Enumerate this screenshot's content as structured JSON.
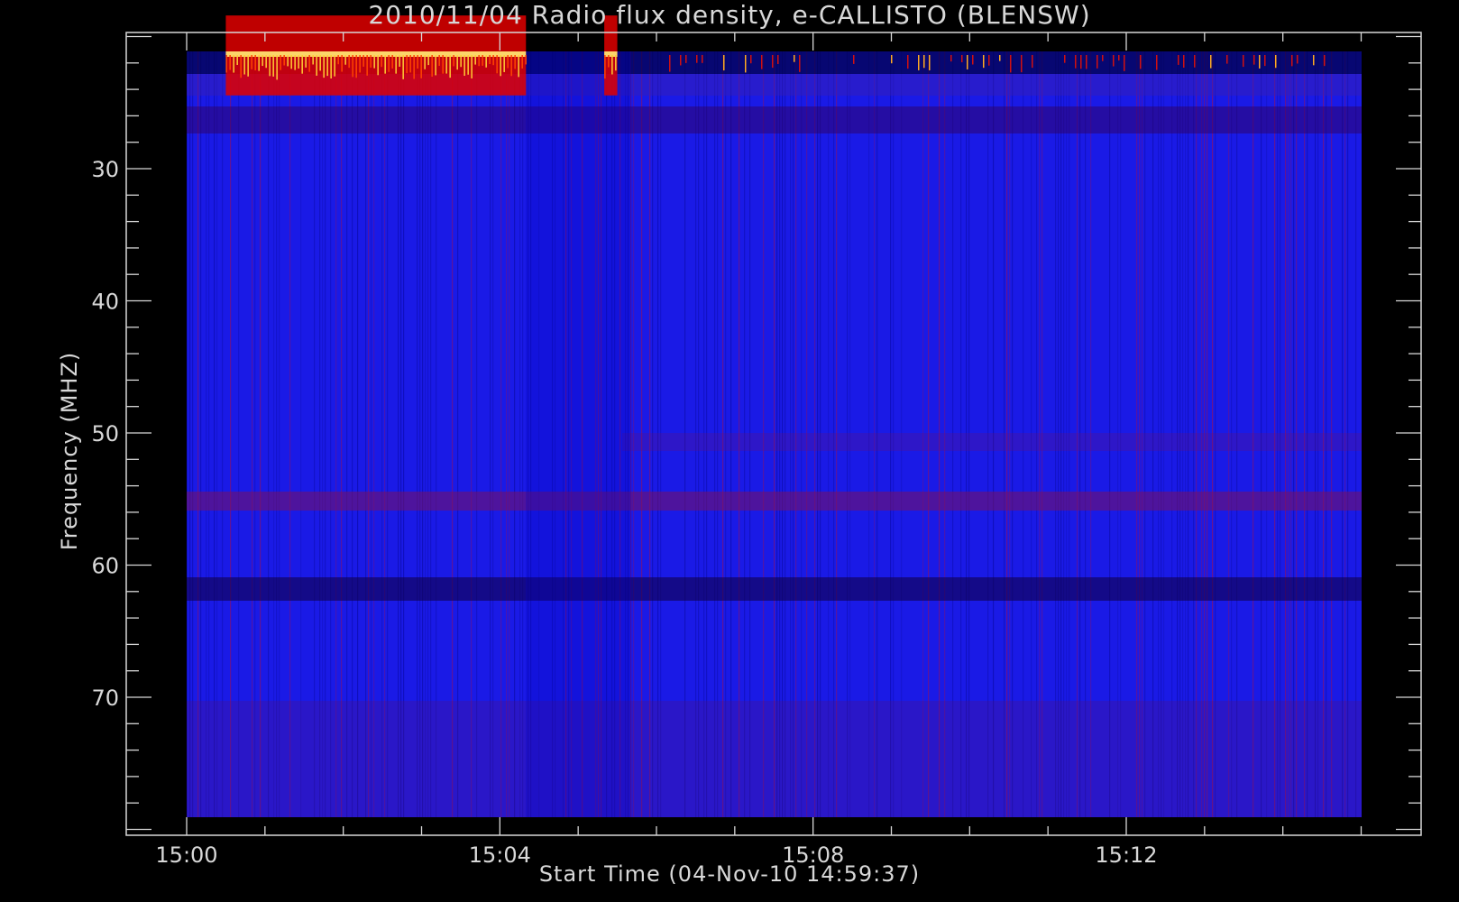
{
  "chart_data": {
    "type": "heatmap",
    "title": "2010/11/04  Radio flux density, e-CALLISTO (BLENSW)",
    "xlabel": "Start Time (04-Nov-10 14:59:37)",
    "ylabel": "Frequency (MHZ)",
    "x_ticks": [
      "15:00",
      "15:04",
      "15:08",
      "15:12"
    ],
    "y_ticks": [
      "30",
      "40",
      "50",
      "60",
      "70"
    ],
    "x_range_minutes": [
      0,
      15.0
    ],
    "y_range_mhz": [
      20,
      80
    ],
    "y_axis_inverted": true,
    "colormap": [
      "#000000",
      "#1010ff",
      "#ff0000",
      "#ffff00"
    ],
    "features": [
      {
        "description": "burst",
        "time_start": "15:00:30",
        "time_end": "15:04:20",
        "freq_mhz": [
          21,
          25
        ]
      },
      {
        "description": "burst",
        "time_start": "15:05:20",
        "time_end": "15:05:30",
        "freq_mhz": [
          21,
          25
        ]
      },
      {
        "description": "band",
        "freq_mhz": [
          55,
          56
        ]
      },
      {
        "description": "band",
        "freq_mhz": [
          61,
          62
        ]
      }
    ]
  }
}
